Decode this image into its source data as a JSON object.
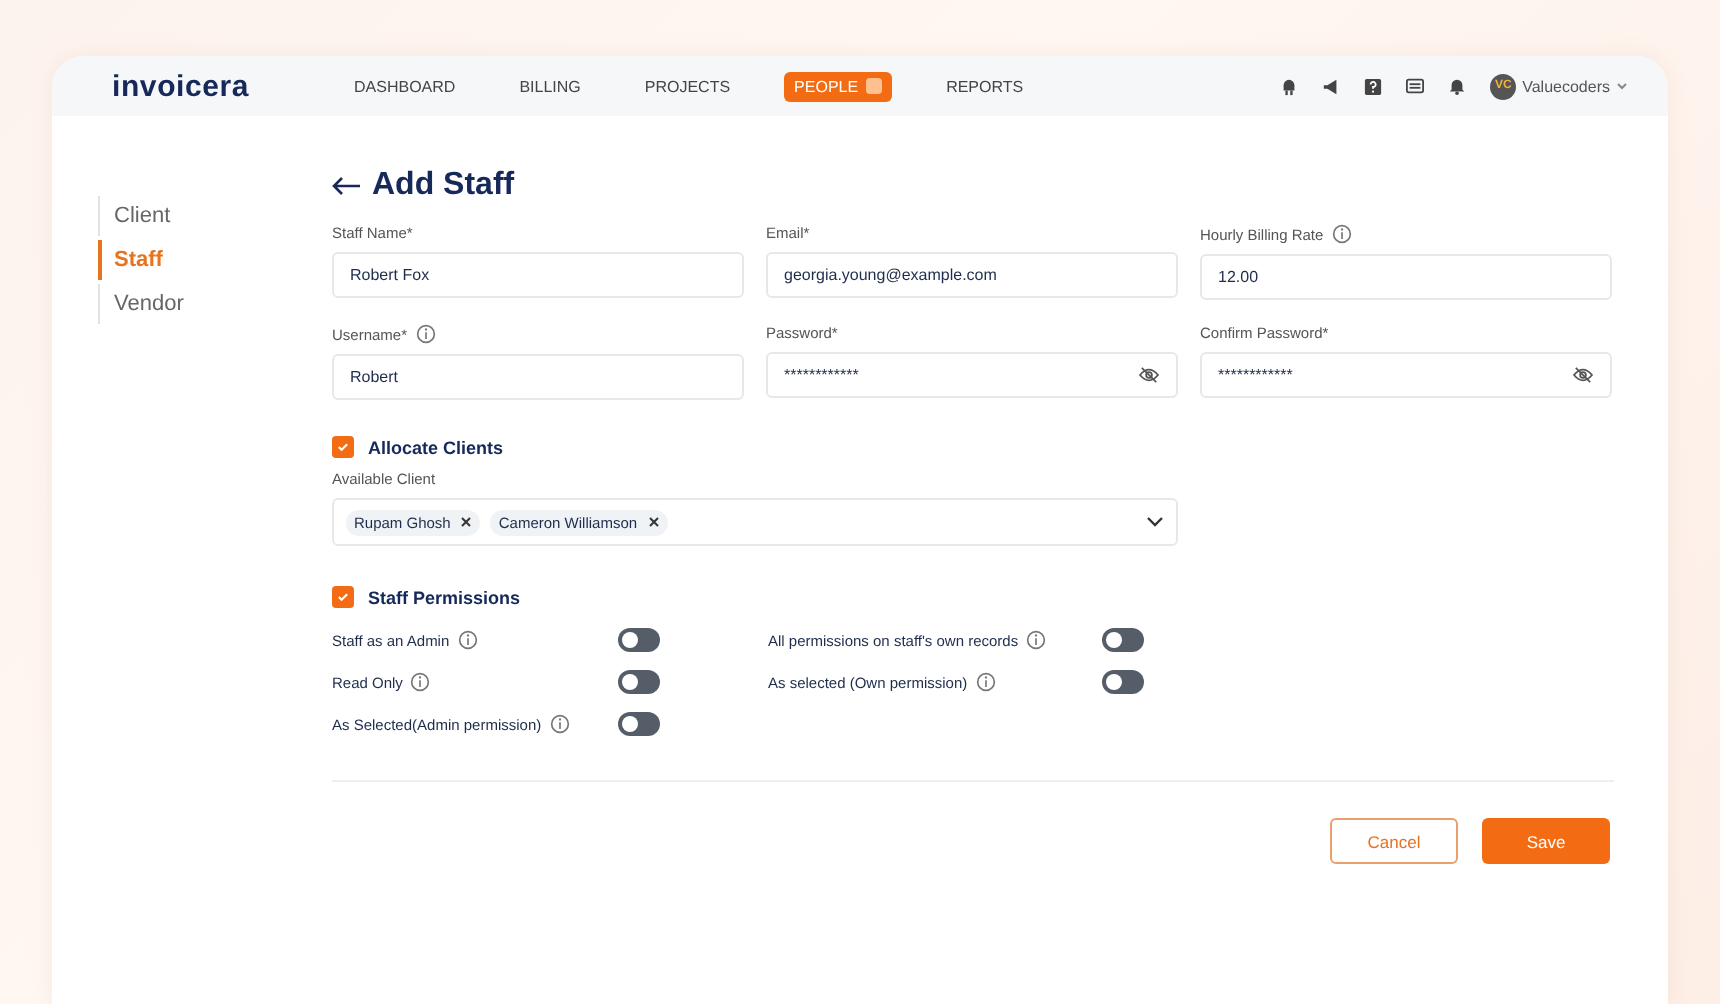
{
  "brand": "invoicera",
  "nav": [
    {
      "label": "DASHBOARD",
      "selected": false
    },
    {
      "label": "BILLING",
      "selected": false
    },
    {
      "label": "PROJECTS",
      "selected": false
    },
    {
      "label": "PEOPLE",
      "selected": true
    },
    {
      "label": "REPORTS",
      "selected": false
    }
  ],
  "user": {
    "initials": "VC",
    "name": "Valuecoders"
  },
  "sidebar": {
    "items": [
      {
        "label": "Client",
        "selected": false
      },
      {
        "label": "Staff",
        "selected": true
      },
      {
        "label": "Vendor",
        "selected": false
      }
    ]
  },
  "page_title": "Add Staff",
  "fields": [
    {
      "label": "Staff Name*",
      "value": "Robert Fox",
      "info": false,
      "kind": "text"
    },
    {
      "label": "Email*",
      "value": "georgia.young@example.com",
      "info": false,
      "kind": "text"
    },
    {
      "label": "Hourly Billing Rate",
      "value": "12.00",
      "info": true,
      "kind": "text"
    },
    {
      "label": "Username*",
      "value": "Robert",
      "info": true,
      "kind": "text"
    },
    {
      "label": "Password*",
      "value": "************",
      "info": false,
      "kind": "password"
    },
    {
      "label": "Confirm Password*",
      "value": "************",
      "info": false,
      "kind": "password"
    }
  ],
  "allocate_clients": {
    "label": "Allocate Clients",
    "checked": true,
    "select_label": "Available Client",
    "chips": [
      "Rupam Ghosh",
      "Cameron Williamson"
    ]
  },
  "staff_permissions": {
    "label": "Staff Permissions",
    "checked": true,
    "toggles": [
      {
        "label": "Staff as an Admin",
        "on": false
      },
      {
        "label": "All permissions on staff's own records",
        "on": false
      },
      {
        "label": "Read Only",
        "on": false
      },
      {
        "label": "As selected (Own permission)",
        "on": false
      },
      {
        "label": "As Selected(Admin permission)",
        "on": false
      }
    ]
  },
  "buttons": {
    "cancel": "Cancel",
    "save": "Save"
  }
}
